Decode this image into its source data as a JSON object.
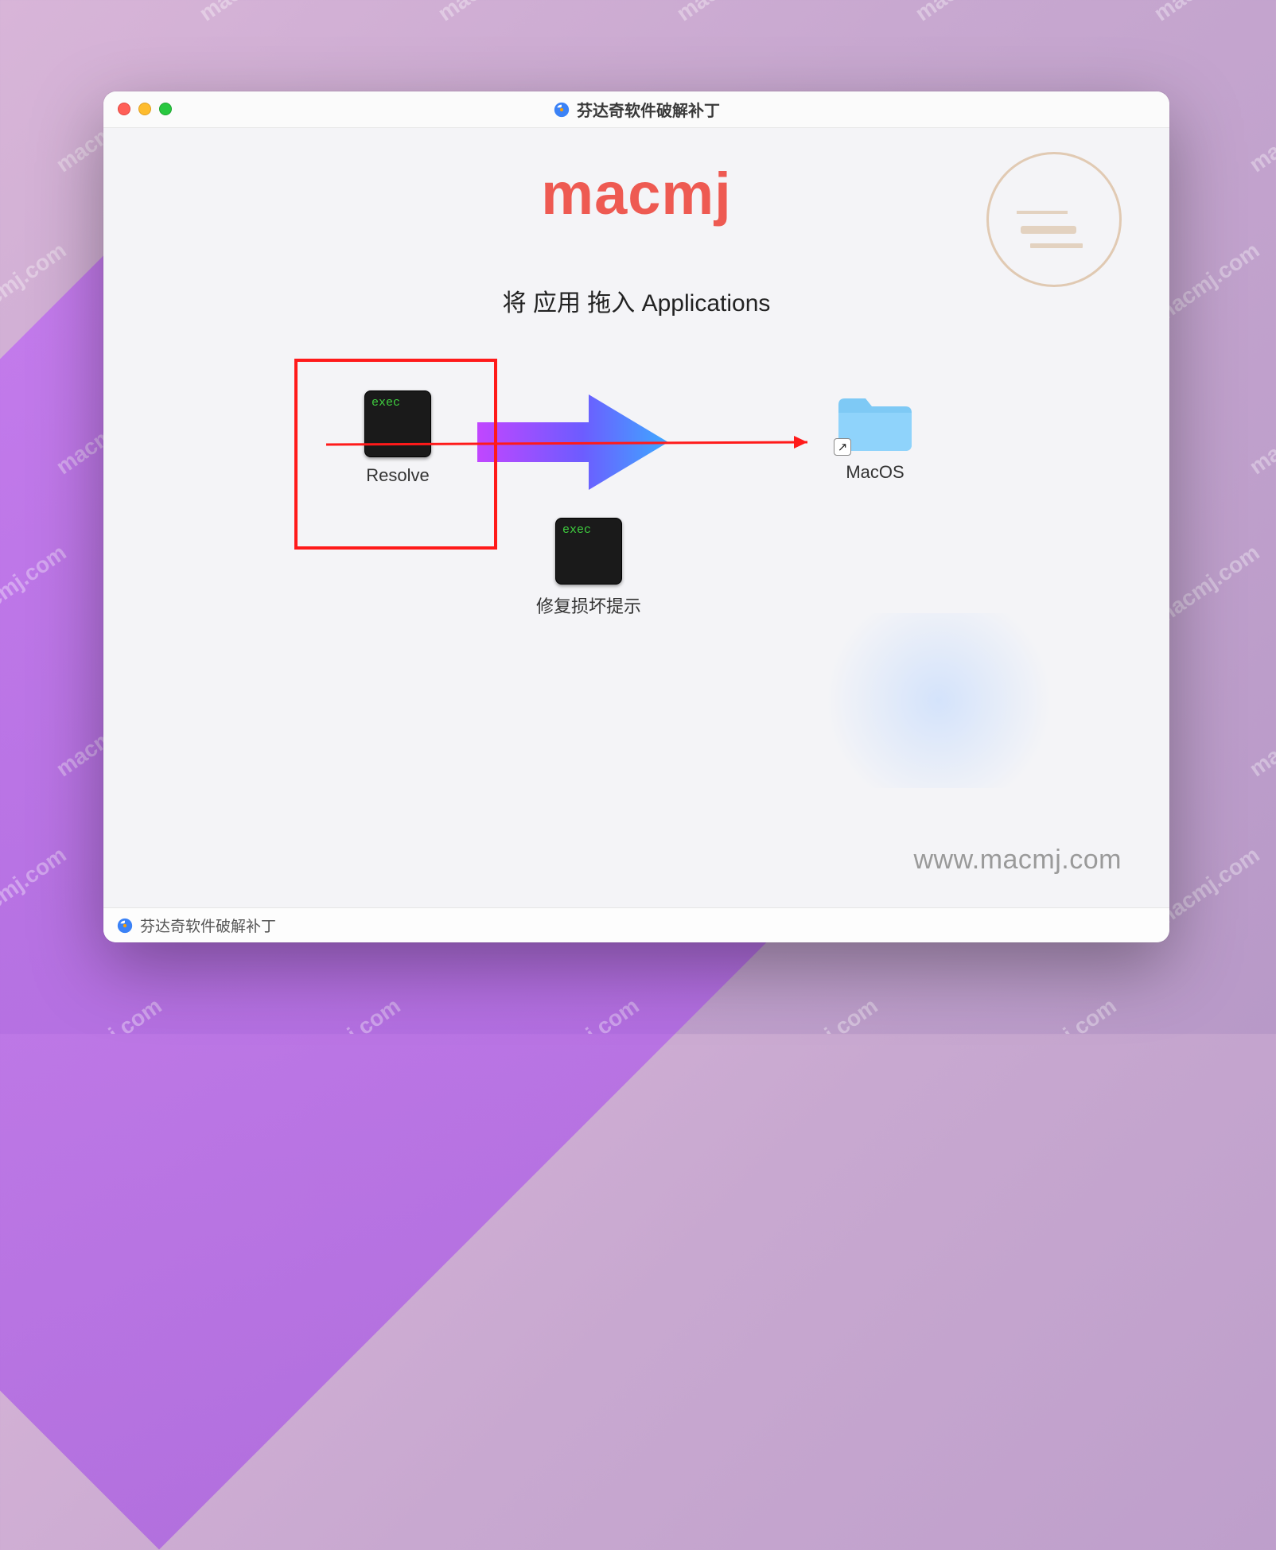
{
  "watermark_text": "macmj.com",
  "window": {
    "title": "芬达奇软件破解补丁",
    "brand": "macmj",
    "instruction": "将 应用 拖入 Applications",
    "footer_url": "www.macmj.com",
    "statusbar_label": "芬达奇软件破解补丁"
  },
  "items": {
    "resolve": {
      "label": "Resolve",
      "exec_text": "exec"
    },
    "macos": {
      "label": "MacOS"
    },
    "repair": {
      "label": "修复损坏提示",
      "exec_text": "exec"
    }
  },
  "icons": {
    "alias_arrow": "↗"
  }
}
